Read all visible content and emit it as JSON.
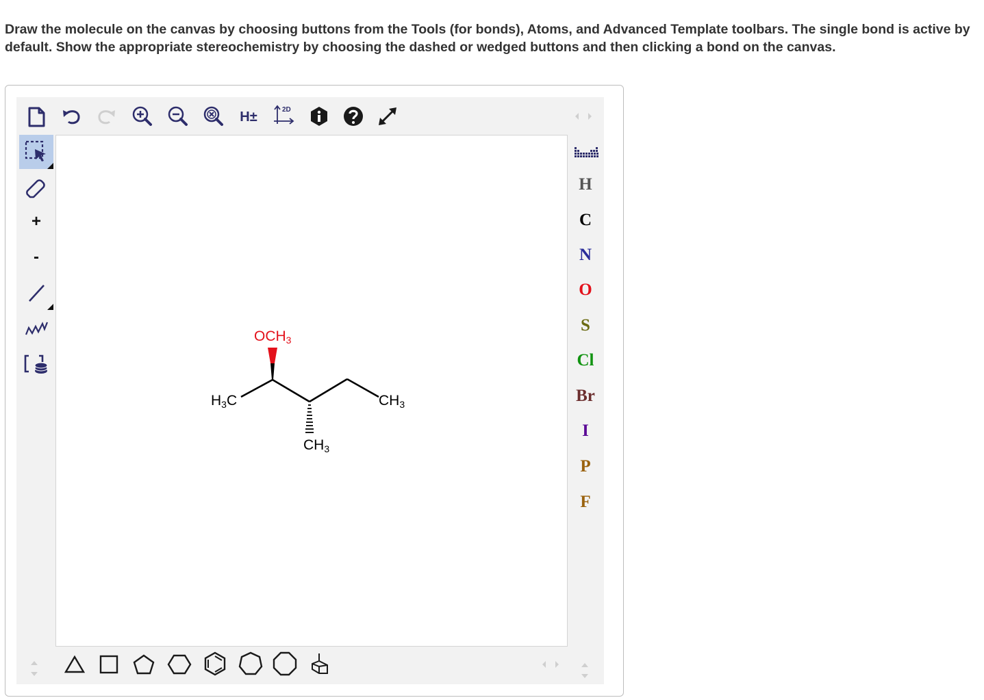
{
  "instructions": "Draw the molecule on the canvas by choosing buttons from the Tools (for bonds), Atoms, and Advanced Template toolbars. The single bond is active by default. Show the appropriate stereochemistry by choosing the dashed or wedged buttons and then clicking a bond on the canvas.",
  "top_toolbar": {
    "new": "new-document-icon",
    "undo": "undo-icon",
    "redo": "redo-icon",
    "zoom_in": "zoom-in-icon",
    "zoom_out": "zoom-out-icon",
    "zoom_reset": "zoom-reset-icon",
    "hydrogens_label": "H±",
    "clean2d_label": "2D",
    "info": "info-icon",
    "help": "help-icon",
    "fullscreen": "fullscreen-icon"
  },
  "left_toolbar": {
    "select": "select-lasso-icon",
    "erase": "eraser-icon",
    "charge_plus": "+",
    "charge_minus": "-",
    "single_bond": "single-bond-icon",
    "chain": "chain-icon",
    "bracket": "bracket-template-icon"
  },
  "atoms": [
    {
      "symbol": "H",
      "color": "#555555"
    },
    {
      "symbol": "C",
      "color": "#000000"
    },
    {
      "symbol": "N",
      "color": "#2b2d9a"
    },
    {
      "symbol": "O",
      "color": "#e3111b"
    },
    {
      "symbol": "S",
      "color": "#6b6b13"
    },
    {
      "symbol": "Cl",
      "color": "#119311"
    },
    {
      "symbol": "Br",
      "color": "#6b2e2e"
    },
    {
      "symbol": "I",
      "color": "#5b0a96"
    },
    {
      "symbol": "P",
      "color": "#9a620e"
    },
    {
      "symbol": "F",
      "color": "#9a620e"
    }
  ],
  "templates": [
    "triangle-icon",
    "square-icon",
    "pentagon-icon",
    "hexagon-icon",
    "benzene-icon",
    "heptagon-icon",
    "octagon-icon",
    "bicyclic-icon"
  ],
  "molecule": {
    "och3_label": {
      "main": "OCH",
      "sub": "3",
      "color": "#e3111b"
    },
    "h3c_label": {
      "pre": "H",
      "sub": "3",
      "post": "C"
    },
    "ch3_right_label": {
      "main": "CH",
      "sub": "3"
    },
    "ch3_down_label": {
      "main": "CH",
      "sub": "3"
    }
  }
}
